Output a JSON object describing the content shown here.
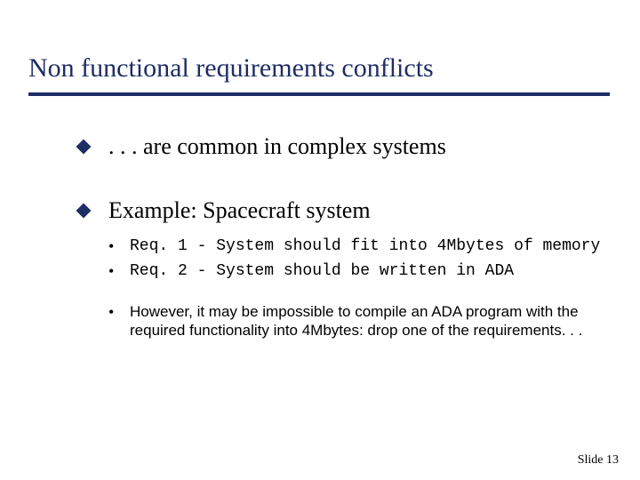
{
  "title": "Non functional requirements conflicts",
  "bullets": [
    {
      "text": ". . . are common in complex systems"
    },
    {
      "text": "Example: Spacecraft system"
    }
  ],
  "sub": {
    "req1": "Req. 1 - System should fit into 4Mbytes of memory",
    "req2": "Req. 2 - System should be written in ADA",
    "note": "However, it may be impossible to compile an ADA program with the required functionality into 4Mbytes: drop one of the requirements. . ."
  },
  "footer": {
    "label": "Slide",
    "number": "13"
  },
  "glyphs": {
    "dot": "•"
  }
}
